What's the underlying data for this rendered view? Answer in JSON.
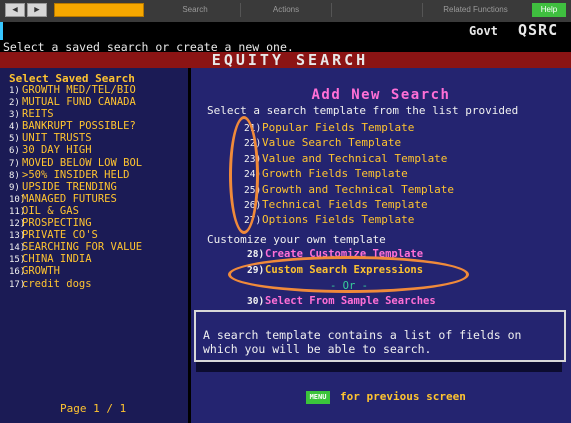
{
  "toolbar": {
    "back_icon": "arrow-left",
    "forward_icon": "arrow-right",
    "menus": [
      "Search",
      "Actions",
      "",
      "Related Functions"
    ],
    "help": "Help"
  },
  "header": {
    "govt": "Govt",
    "code": "QSRC",
    "prompt": "Select a saved search or create a new one.",
    "title": "EQUITY SEARCH"
  },
  "saved_searches": {
    "title": "Select Saved Search",
    "items": [
      {
        "num": "1)",
        "label": "GROWTH MED/TEL/BIO"
      },
      {
        "num": "2)",
        "label": "MUTUAL FUND CANADA"
      },
      {
        "num": "3)",
        "label": "REITS"
      },
      {
        "num": "4)",
        "label": "BANKRUPT POSSIBLE?"
      },
      {
        "num": "5)",
        "label": "UNIT TRUSTS"
      },
      {
        "num": "6)",
        "label": "30 DAY HIGH"
      },
      {
        "num": "7)",
        "label": "MOVED BELOW LOW BOL"
      },
      {
        "num": "8)",
        "label": ">50% INSIDER HELD"
      },
      {
        "num": "9)",
        "label": "UPSIDE TRENDING"
      },
      {
        "num": "10)",
        "label": "MANAGED FUTURES"
      },
      {
        "num": "11)",
        "label": "OIL & GAS"
      },
      {
        "num": "12)",
        "label": "PROSPECTING"
      },
      {
        "num": "13)",
        "label": "PRIVATE CO'S"
      },
      {
        "num": "14)",
        "label": "SEARCHING FOR VALUE"
      },
      {
        "num": "15)",
        "label": "CHINA INDIA"
      },
      {
        "num": "16)",
        "label": "GROWTH"
      },
      {
        "num": "17)",
        "label": "credit dogs"
      }
    ],
    "page": "Page 1 / 1"
  },
  "add_new": {
    "title": "Add New Search",
    "instruction": "Select a search template from the list provided",
    "templates": [
      {
        "num": "21)",
        "label": "Popular Fields Template"
      },
      {
        "num": "22)",
        "label": "Value Search Template"
      },
      {
        "num": "23)",
        "label": "Value and Technical Template"
      },
      {
        "num": "24)",
        "label": "Growth Fields Template"
      },
      {
        "num": "25)",
        "label": "Growth and Technical Template"
      },
      {
        "num": "26)",
        "label": "Technical Fields Template"
      },
      {
        "num": "27)",
        "label": "Options Fields Template"
      }
    ],
    "customize_label": "Customize your own template",
    "create_num": "28)",
    "create_label": "Create Customize Template",
    "custom_num": "29)",
    "custom_label": "Custom Search Expressions",
    "or_text": "- Or -",
    "sample_num": "30)",
    "sample_label": "Select From Sample Searches",
    "info_text": "A search template contains a list of fields on which you will be able to search."
  },
  "footer": {
    "menu_key": "MENU",
    "menu_text": "for previous screen"
  },
  "colors": {
    "accent_orange": "#ffc430",
    "title_pink": "#ff6fd6",
    "panel_navy": "#242470",
    "header_red": "#8b1414",
    "annotation_orange": "#f08a3a"
  }
}
